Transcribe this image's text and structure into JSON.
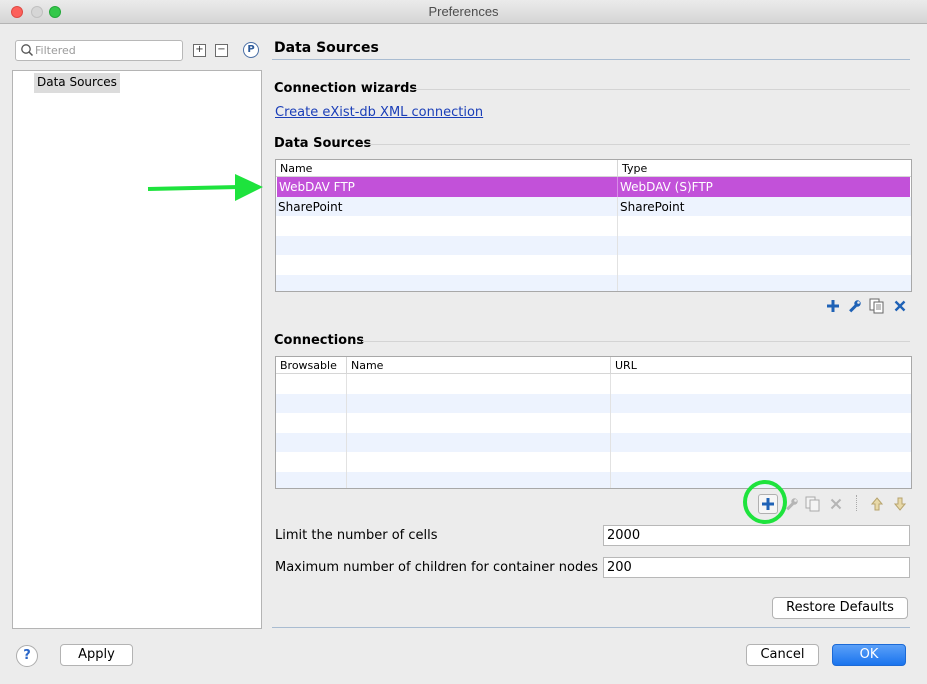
{
  "window": {
    "title": "Preferences"
  },
  "sidebar": {
    "filter_placeholder": "Filtered",
    "tree_items": [
      "Data Sources"
    ]
  },
  "page": {
    "title": "Data Sources",
    "wizards": {
      "label": "Connection wizards",
      "link": "Create eXist-db XML connection"
    },
    "data_sources": {
      "label": "Data Sources",
      "columns": [
        "Name",
        "Type"
      ],
      "rows": [
        {
          "name": "WebDAV FTP",
          "type": "WebDAV (S)FTP",
          "selected": true
        },
        {
          "name": "SharePoint",
          "type": "SharePoint",
          "selected": false
        }
      ]
    },
    "connections": {
      "label": "Connections",
      "columns": [
        "Browsable",
        "Name",
        "URL"
      ],
      "rows": []
    },
    "limit_cells": {
      "label": "Limit the number of cells",
      "value": "2000"
    },
    "max_children": {
      "label": "Maximum number of children for container nodes",
      "value": "200"
    },
    "restore_defaults": "Restore Defaults"
  },
  "footer": {
    "help": "?",
    "apply": "Apply",
    "cancel": "Cancel",
    "ok": "OK"
  },
  "colors": {
    "selection": "#c251d9",
    "annotation": "#1ee33d",
    "link": "#1a3eb8",
    "primary_button": "#1a74ee"
  }
}
